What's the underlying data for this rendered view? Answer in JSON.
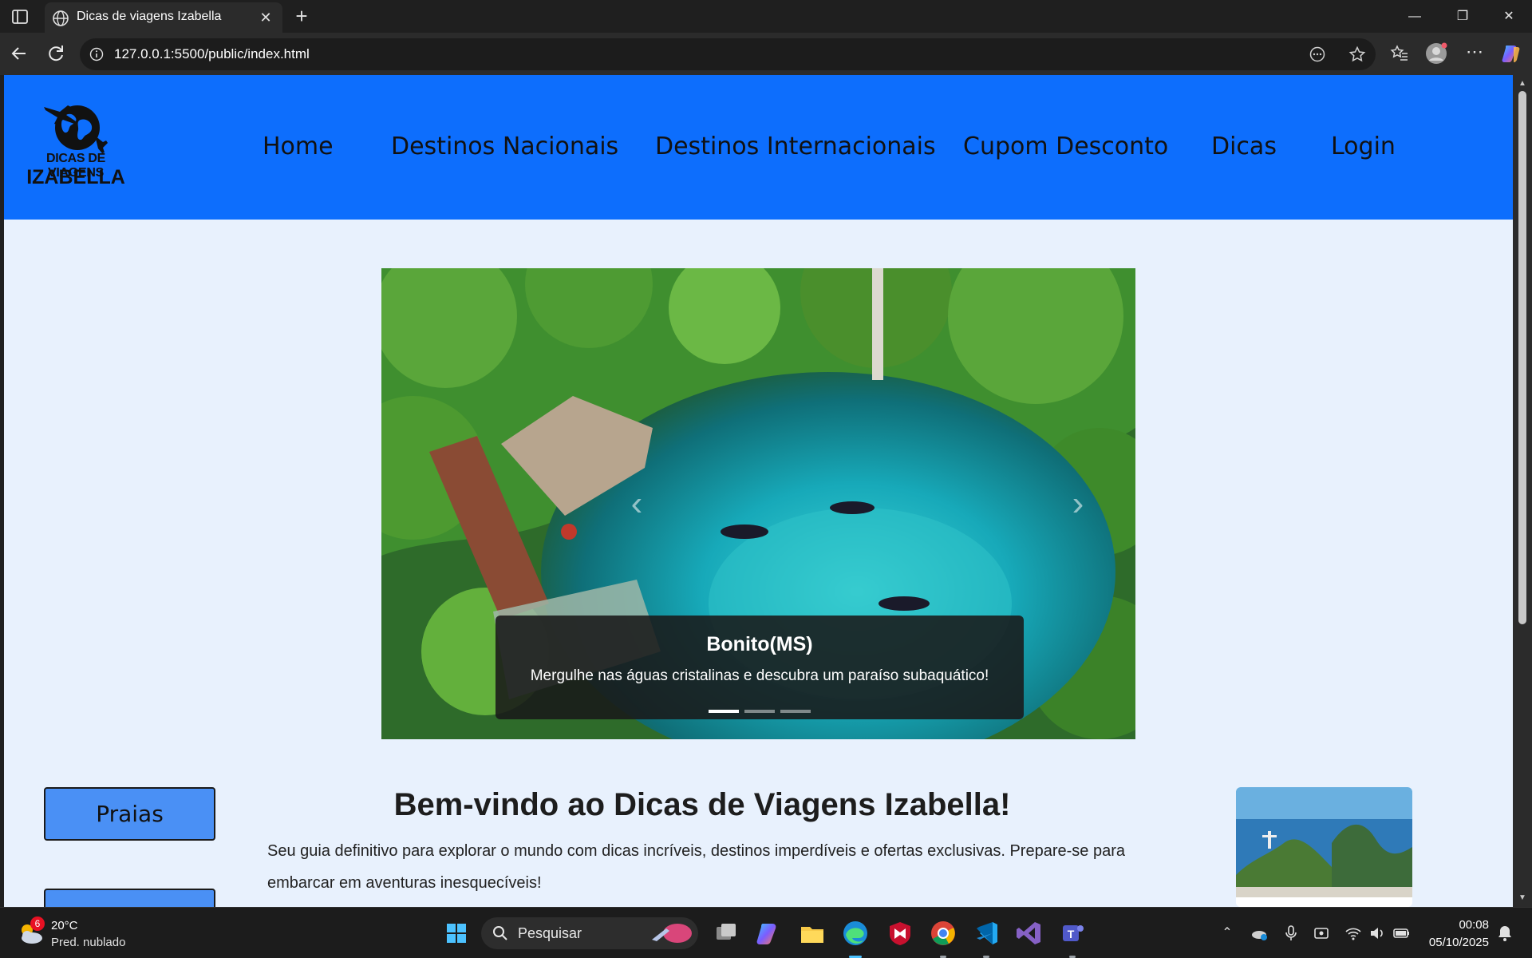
{
  "browser": {
    "tab_title": "Dicas de viagens Izabella",
    "url": "127.0.0.1:5500/public/index.html"
  },
  "site": {
    "logo_line1": "DICAS DE VIAGENS",
    "logo_line2": "IZABELLA",
    "nav": [
      "Home",
      "Destinos Nacionais",
      "Destinos Internacionais",
      "Cupom Desconto",
      "Dicas",
      "Login"
    ],
    "header_color": "#0d6efd",
    "page_bg": "#e8f1fd"
  },
  "carousel": {
    "slide_title": "Bonito(MS)",
    "slide_text": "Mergulhe nas águas cristalinas e descubra um paraíso subaquático!",
    "slide_count": 3,
    "active_index": 0
  },
  "sidebar": {
    "buttons": [
      "Praias",
      ""
    ]
  },
  "welcome": {
    "title": "Bem-vindo ao Dicas de Viagens Izabella!",
    "text": "Seu guia definitivo para explorar o mundo com dicas incríveis, destinos imperdíveis e ofertas exclusivas. Prepare-se para embarcar em aventuras inesquecíveis!"
  },
  "taskbar": {
    "weather_temp": "20°C",
    "weather_desc": "Pred. nublado",
    "weather_badge": "6",
    "search_placeholder": "Pesquisar",
    "time": "00:08",
    "date": "05/10/2025"
  }
}
